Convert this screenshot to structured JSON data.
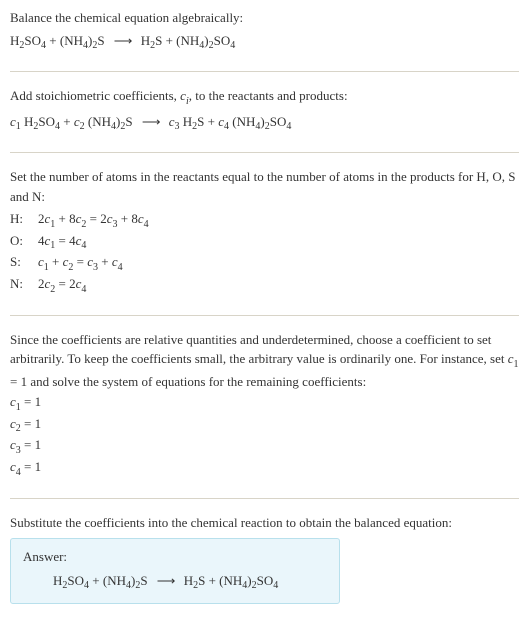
{
  "section1": {
    "intro": "Balance the chemical equation algebraically:",
    "eq_parts": {
      "r1": "H",
      "r1s1": "2",
      "r1b": "SO",
      "r1s2": "4",
      "plus1": " + ",
      "r2a": "(NH",
      "r2s1": "4",
      "r2b": ")",
      "r2s2": "2",
      "r2c": "S",
      "arrow": "⟶",
      "p1": "H",
      "p1s1": "2",
      "p1b": "S",
      "plus2": " + ",
      "p2a": "(NH",
      "p2s1": "4",
      "p2b": ")",
      "p2s2": "2",
      "p2c": "SO",
      "p2s3": "4"
    }
  },
  "section2": {
    "intro_a": "Add stoichiometric coefficients, ",
    "intro_c": "c",
    "intro_ci": "i",
    "intro_b": ", to the reactants and products:",
    "eq": {
      "c1": "c",
      "c1s": "1",
      "sp1": " ",
      "r1": "H",
      "r1s1": "2",
      "r1b": "SO",
      "r1s2": "4",
      "plus1": " + ",
      "c2": "c",
      "c2s": "2",
      "sp2": " ",
      "r2a": "(NH",
      "r2s1": "4",
      "r2b": ")",
      "r2s2": "2",
      "r2c": "S",
      "arrow": "⟶",
      "c3": "c",
      "c3s": "3",
      "sp3": " ",
      "p1": "H",
      "p1s1": "2",
      "p1b": "S",
      "plus2": " + ",
      "c4": "c",
      "c4s": "4",
      "sp4": " ",
      "p2a": "(NH",
      "p2s1": "4",
      "p2b": ")",
      "p2s2": "2",
      "p2c": "SO",
      "p2s3": "4"
    }
  },
  "section3": {
    "intro": "Set the number of atoms in the reactants equal to the number of atoms in the products for H, O, S and N:",
    "rows": {
      "H": {
        "label": "H:",
        "lhs_a": "2",
        "c1": "c",
        "c1s": "1",
        "plus1": " + 8",
        "c2": "c",
        "c2s": "2",
        "eq": " = 2",
        "c3": "c",
        "c3s": "3",
        "plus2": " + 8",
        "c4": "c",
        "c4s": "4"
      },
      "O": {
        "label": "O:",
        "lhs_a": "4",
        "c1": "c",
        "c1s": "1",
        "eq": " = 4",
        "c4": "c",
        "c4s": "4"
      },
      "S": {
        "label": " S:",
        "c1": "c",
        "c1s": "1",
        "plus1": " + ",
        "c2": "c",
        "c2s": "2",
        "eq": " = ",
        "c3": "c",
        "c3s": "3",
        "plus2": " + ",
        "c4": "c",
        "c4s": "4"
      },
      "N": {
        "label": "N:",
        "lhs_a": "2",
        "c2": "c",
        "c2s": "2",
        "eq": " = 2",
        "c4": "c",
        "c4s": "4"
      }
    }
  },
  "section4": {
    "intro_a": "Since the coefficients are relative quantities and underdetermined, choose a coefficient to set arbitrarily. To keep the coefficients small, the arbitrary value is ordinarily one. For instance, set ",
    "c1": "c",
    "c1s": "1",
    "intro_b": " = 1 and solve the system of equations for the remaining coefficients:",
    "coefs": {
      "l1a": "c",
      "l1s": "1",
      "l1b": " = 1",
      "l2a": "c",
      "l2s": "2",
      "l2b": " = 1",
      "l3a": "c",
      "l3s": "3",
      "l3b": " = 1",
      "l4a": "c",
      "l4s": "4",
      "l4b": " = 1"
    }
  },
  "section5": {
    "intro": "Substitute the coefficients into the chemical reaction to obtain the balanced equation:",
    "answer_label": "Answer:",
    "eq": {
      "r1": "H",
      "r1s1": "2",
      "r1b": "SO",
      "r1s2": "4",
      "plus1": " + ",
      "r2a": "(NH",
      "r2s1": "4",
      "r2b": ")",
      "r2s2": "2",
      "r2c": "S",
      "arrow": "⟶",
      "p1": "H",
      "p1s1": "2",
      "p1b": "S",
      "plus2": " + ",
      "p2a": "(NH",
      "p2s1": "4",
      "p2b": ")",
      "p2s2": "2",
      "p2c": "SO",
      "p2s3": "4"
    }
  }
}
